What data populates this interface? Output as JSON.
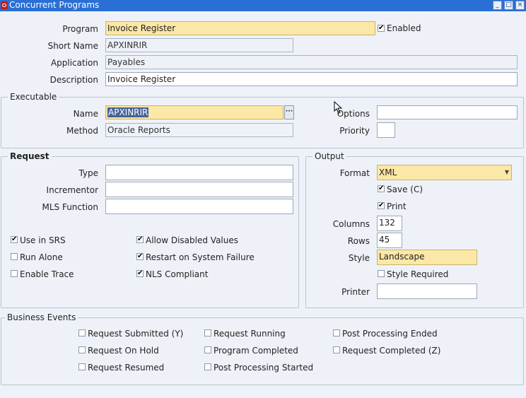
{
  "window": {
    "title": "Concurrent Programs",
    "buttons": [
      "_",
      "□",
      "×"
    ]
  },
  "header": {
    "program_label": "Program",
    "program_value": "Invoice Register",
    "enabled_label": "Enabled",
    "enabled_checked": "✔",
    "short_name_label": "Short Name",
    "short_name_value": "APXINRIR",
    "application_label": "Application",
    "application_value": "Payables",
    "description_label": "Description",
    "description_value": "Invoice Register"
  },
  "executable": {
    "legend": "Executable",
    "name_label": "Name",
    "name_value": "APXINRIR",
    "lov_button": "···",
    "method_label": "Method",
    "method_value": "Oracle Reports",
    "options_label": "Options",
    "options_value": "",
    "priority_label": "Priority",
    "priority_value": ""
  },
  "request": {
    "legend": "Request",
    "type_label": "Type",
    "type_value": "",
    "incrementor_label": "Incrementor",
    "incrementor_value": "",
    "mls_label": "MLS Function",
    "mls_value": "",
    "checks": [
      {
        "label": "Use in SRS",
        "mark": "✔"
      },
      {
        "label": "Run Alone",
        "mark": ""
      },
      {
        "label": "Enable Trace",
        "mark": ""
      },
      {
        "label": "Allow Disabled Values",
        "mark": "✔"
      },
      {
        "label": "Restart on System Failure",
        "mark": "✔"
      },
      {
        "label": "NLS Compliant",
        "mark": "✔"
      }
    ]
  },
  "output": {
    "legend": "Output",
    "format_label": "Format",
    "format_value": "XML",
    "dropdown_icon": "▼",
    "save_label": "Save (C)",
    "save_mark": "✔",
    "print_label": "Print",
    "print_mark": "✔",
    "columns_label": "Columns",
    "columns_value": "132",
    "rows_label": "Rows",
    "rows_value": "45",
    "style_label": "Style",
    "style_value": "Landscape",
    "style_required_label": "Style Required",
    "style_required_mark": "",
    "printer_label": "Printer",
    "printer_value": ""
  },
  "business_events": {
    "legend": "Business Events",
    "items": [
      {
        "label": "Request Submitted (Y)",
        "mark": ""
      },
      {
        "label": "Request On Hold",
        "mark": ""
      },
      {
        "label": "Request Resumed",
        "mark": ""
      },
      {
        "label": "Request Running",
        "mark": ""
      },
      {
        "label": "Program Completed",
        "mark": ""
      },
      {
        "label": "Post Processing Started",
        "mark": ""
      },
      {
        "label": "Post Processing Ended",
        "mark": ""
      },
      {
        "label": "Request Completed (Z)",
        "mark": ""
      }
    ]
  }
}
